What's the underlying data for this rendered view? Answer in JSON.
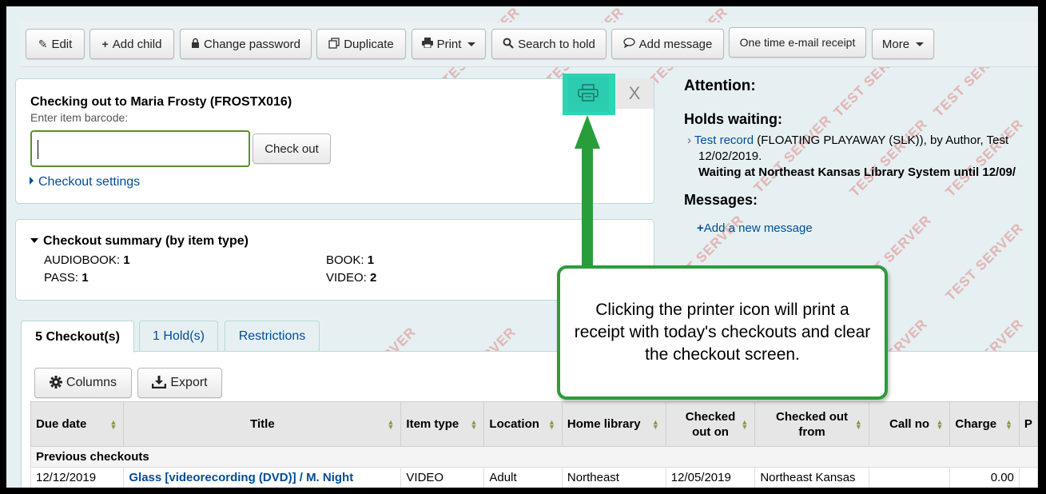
{
  "toolbar": {
    "edit": "Edit",
    "add_child": "Add child",
    "change_password": "Change password",
    "duplicate": "Duplicate",
    "print": "Print",
    "search_to_hold": "Search to hold",
    "add_message": "Add message",
    "one_time_receipt": "One time e-mail receipt",
    "more": "More"
  },
  "checkout": {
    "title": "Checking out to Maria Frosty (FROSTX016)",
    "barcode_label": "Enter item barcode:",
    "barcode_value": "",
    "checkout_button": "Check out",
    "settings_link": "Checkout settings",
    "close_label": "X"
  },
  "summary": {
    "title": "Checkout summary (by item type)",
    "items": [
      {
        "label": "AUDIOBOOK:",
        "count": "1"
      },
      {
        "label": "BOOK:",
        "count": "1"
      },
      {
        "label": "PASS:",
        "count": "1"
      },
      {
        "label": "VIDEO:",
        "count": "2"
      }
    ]
  },
  "attention": {
    "heading": "Attention:",
    "holds_heading": "Holds waiting:",
    "hold_link": "Test record",
    "hold_text": "(FLOATING PLAYAWAY (SLK)), by Author, Test",
    "hold_date": "12/02/2019.",
    "hold_waiting": "Waiting at Northeast Kansas Library System until 12/09/",
    "messages_heading": "Messages:",
    "add_message_link": "Add a new message"
  },
  "tabs": [
    {
      "label": "5 Checkout(s)"
    },
    {
      "label": "1 Hold(s)"
    },
    {
      "label": "Restrictions"
    }
  ],
  "table_tools": {
    "columns": "Columns",
    "export": "Export"
  },
  "table": {
    "headers": [
      "Due date",
      "Title",
      "Item type",
      "Location",
      "Home library",
      "Checked out on",
      "Checked out from",
      "Call no",
      "Charge",
      "P"
    ],
    "group_label": "Previous checkouts",
    "rows": [
      {
        "due": "12/12/2019",
        "title": "Glass [videorecording (DVD)] / M. Night",
        "type": "VIDEO",
        "location": "Adult",
        "home": "Northeast",
        "out_on": "12/05/2019",
        "out_from": "Northeast Kansas",
        "call_no": "",
        "charge": "0.00",
        "price": ""
      }
    ]
  },
  "callout": {
    "text": "Clicking the printer icon will print a receipt with today's checkouts and clear the checkout screen."
  },
  "watermark": "TEST SERVER",
  "colors": {
    "accent": "#004d99",
    "callout_green": "#2a9d3b",
    "print_highlight": "#2bd6b5"
  }
}
